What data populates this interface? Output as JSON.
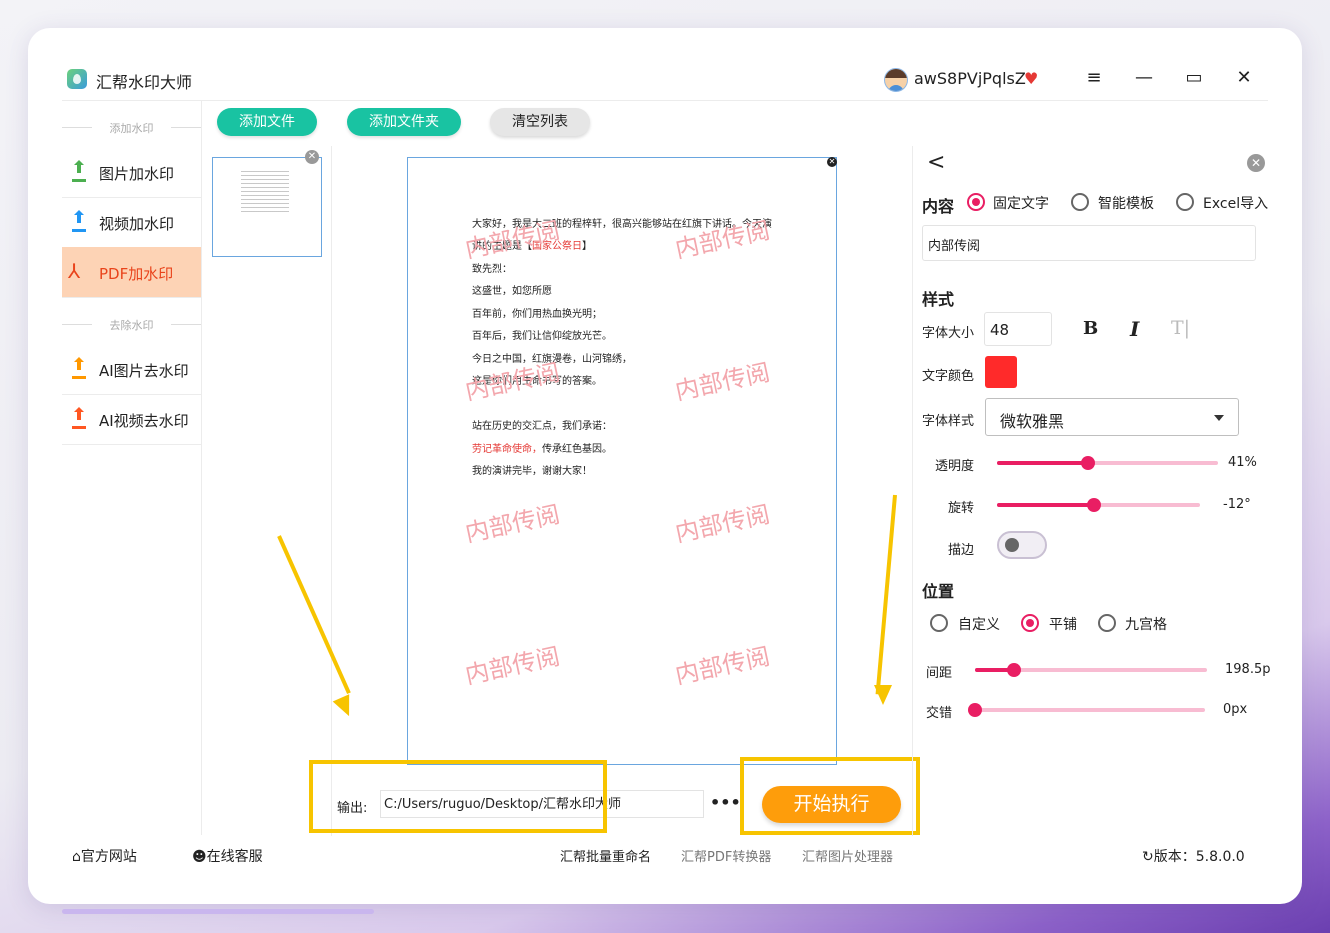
{
  "app": {
    "title": "汇帮水印大师",
    "username": "awS8PVjPqlsZ"
  },
  "window_controls": {
    "menu": "≡",
    "minimize": "—",
    "maximize": "▭",
    "close": "✕"
  },
  "sidebar": {
    "add_section": "添加水印",
    "remove_section": "去除水印",
    "items": [
      {
        "label": "图片加水印",
        "color": "#4caf50"
      },
      {
        "label": "视频加水印",
        "color": "#2196f3"
      },
      {
        "label": "PDF加水印",
        "color": "#e9441c"
      },
      {
        "label": "AI图片去水印",
        "color": "#ff9800"
      },
      {
        "label": "AI视频去水印",
        "color": "#ff5722"
      }
    ]
  },
  "toolbar": {
    "add_file": "添加文件",
    "add_folder": "添加文件夹",
    "clear_list": "清空列表"
  },
  "document": {
    "lines": [
      {
        "parts": [
          {
            "t": "大家好，我是大二班的程梓轩，很高兴能够站在红旗下讲话。今天演",
            "red": false
          }
        ]
      },
      {
        "parts": [
          {
            "t": "讲的主题是【",
            "red": false
          },
          {
            "t": "国家公祭日",
            "red": true
          },
          {
            "t": "】",
            "red": false
          }
        ]
      },
      {
        "parts": [
          {
            "t": "致先烈：",
            "red": false
          }
        ]
      },
      {
        "parts": [
          {
            "t": "这盛世，如您所愿",
            "red": false
          }
        ]
      },
      {
        "parts": [
          {
            "t": "百年前，你们用热血换光明；",
            "red": false
          }
        ]
      },
      {
        "parts": [
          {
            "t": "百年后，我们让信仰绽放光芒。",
            "red": false
          }
        ]
      },
      {
        "parts": [
          {
            "t": "今日之中国，红旗漫卷，山河锦绣，",
            "red": false
          }
        ]
      },
      {
        "parts": [
          {
            "t": "这是你们用生命书写的答案。",
            "red": false
          }
        ]
      },
      {
        "parts": [
          {
            "t": "",
            "red": false
          }
        ]
      },
      {
        "parts": [
          {
            "t": "站在历史的交汇点，我们承诺：",
            "red": false
          }
        ]
      },
      {
        "parts": [
          {
            "t": "劳记革命使命，",
            "red": true
          },
          {
            "t": "传承红色基因。",
            "red": false
          }
        ]
      },
      {
        "parts": [
          {
            "t": "我的演讲完毕，谢谢大家！",
            "red": false
          }
        ]
      }
    ],
    "watermark": "内部传阅"
  },
  "output": {
    "label": "输出:",
    "path": "C:/Users/ruguo/Desktop/汇帮水印大师",
    "more": "•••"
  },
  "start_button": "开始执行",
  "settings": {
    "back": "<",
    "content_label": "内容",
    "content_options": [
      {
        "label": "固定文字",
        "selected": true
      },
      {
        "label": "智能模板",
        "selected": false
      },
      {
        "label": "Excel导入",
        "selected": false
      }
    ],
    "text_value": "内部传阅",
    "style_title": "样式",
    "font_size_label": "字体大小",
    "font_size": "48",
    "bold": "B",
    "italic": "I",
    "clear_format": "T|",
    "color_label": "文字颜色",
    "text_color": "#ff2a2a",
    "font_style_label": "字体样式",
    "font_style_value": "微软雅黑",
    "opacity_label": "透明度",
    "opacity_value": "41%",
    "opacity_fraction": 0.41,
    "rotation_label": "旋转",
    "rotation_value": "-12°",
    "rotation_fraction": 0.48,
    "stroke_label": "描边",
    "stroke_on": false,
    "position_title": "位置",
    "position_options": [
      {
        "label": "自定义",
        "selected": false
      },
      {
        "label": "平铺",
        "selected": true
      },
      {
        "label": "九宫格",
        "selected": false
      }
    ],
    "spacing_label": "间距",
    "spacing_value": "198.5p",
    "spacing_fraction": 0.17,
    "offset_label": "交错",
    "offset_value": "0px",
    "offset_fraction": 0.0
  },
  "footer": {
    "website": "官方网站",
    "support": "在线客服",
    "links": [
      "汇帮批量重命名",
      "汇帮PDF转换器",
      "汇帮图片处理器"
    ],
    "version": "版本：5.8.0.0"
  },
  "colors": {
    "accent_green": "#19c3a2",
    "accent_orange": "#fe9d0b",
    "accent_pink": "#e91e63",
    "highlight": "#f7c400"
  }
}
